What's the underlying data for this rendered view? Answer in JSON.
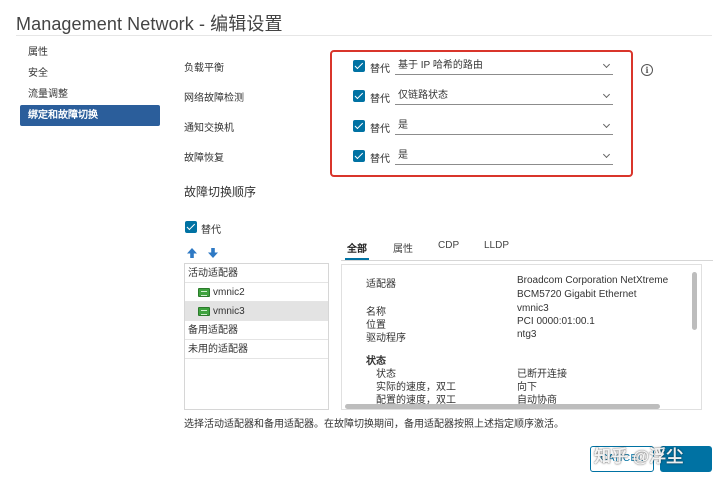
{
  "window": {
    "title": "Management Network - 编辑设置"
  },
  "sidebar": {
    "items": [
      {
        "label": "属性"
      },
      {
        "label": "安全"
      },
      {
        "label": "流量调整"
      },
      {
        "label": "绑定和故障切换",
        "active": true
      }
    ]
  },
  "settings": {
    "rows": [
      {
        "label": "负载平衡",
        "override_label": "替代",
        "override_checked": true,
        "value": "基于 IP 哈希的路由"
      },
      {
        "label": "网络故障检测",
        "override_label": "替代",
        "override_checked": true,
        "value": "仅链路状态"
      },
      {
        "label": "通知交换机",
        "override_label": "替代",
        "override_checked": true,
        "value": "是"
      },
      {
        "label": "故障恢复",
        "override_label": "替代",
        "override_checked": true,
        "value": "是"
      }
    ],
    "info_icon": "info-icon",
    "highlight_color": "#d9352b"
  },
  "failover": {
    "title": "故障切换顺序",
    "override_label": "替代",
    "override_checked": true,
    "move_up_icon": "arrow-up-icon",
    "move_down_icon": "arrow-down-icon",
    "groups": {
      "active": "活动适配器",
      "standby": "备用适配器",
      "unused": "未用的适配器"
    },
    "adapters": [
      {
        "name": "vmnic2",
        "selected": false
      },
      {
        "name": "vmnic3",
        "selected": true
      }
    ]
  },
  "details": {
    "tabs": [
      {
        "label": "全部",
        "active": true
      },
      {
        "label": "属性"
      },
      {
        "label": "CDP"
      },
      {
        "label": "LLDP"
      }
    ],
    "adapter_label": "适配器",
    "adapter_value_line1": "Broadcom Corporation NetXtreme",
    "adapter_value_line2": "BCM5720 Gigabit Ethernet",
    "name_label": "名称",
    "name_value": "vmnic3",
    "location_label": "位置",
    "location_value": "PCI 0000:01:00.1",
    "driver_label": "驱动程序",
    "driver_value": "ntg3",
    "status_section": "状态",
    "status_label": "状态",
    "status_value": "已断开连接",
    "actual_speed_label": "实际的速度，双工",
    "actual_speed_value": "向下",
    "configured_speed_label": "配置的速度，双工",
    "configured_speed_value": "自动协商"
  },
  "hint": "选择活动适配器和备用适配器。在故障切换期间，备用适配器按照上述指定顺序激活。",
  "footer": {
    "cancel_label": "CANCEL",
    "accent_color": "#0072a3"
  },
  "watermark": "知乎 @浮尘"
}
